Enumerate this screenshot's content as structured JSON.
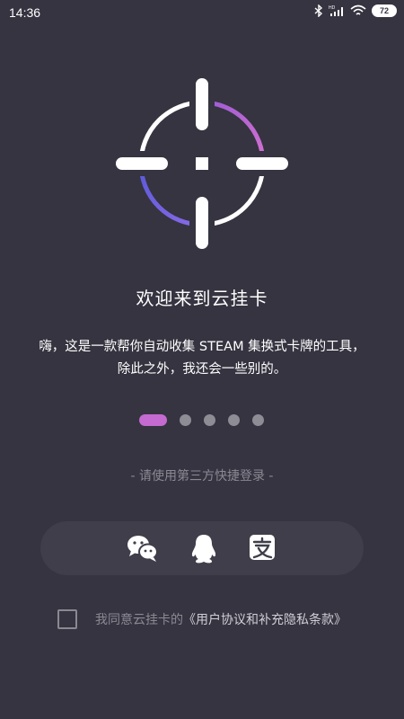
{
  "status_bar": {
    "time": "14:36",
    "battery": "72",
    "icons": [
      "bluetooth-icon",
      "hd-signal-icon",
      "wifi-icon",
      "battery-icon"
    ]
  },
  "welcome": {
    "title": "欢迎来到云挂卡",
    "description": "嗨，这是一款帮你自动收集 STEAM 集换式卡牌的工具，除此之外，我还会一些别的。"
  },
  "pager": {
    "total": 5,
    "active_index": 0
  },
  "login": {
    "divider_label": "- 请使用第三方快捷登录 -",
    "providers": [
      {
        "name": "wechat",
        "icon": "wechat-icon"
      },
      {
        "name": "qq",
        "icon": "qq-icon"
      },
      {
        "name": "alipay",
        "icon": "alipay-icon"
      }
    ]
  },
  "agreement": {
    "checked": false,
    "prefix": "我同意云挂卡的",
    "link": "《用户协议和补充隐私条款》"
  },
  "colors": {
    "background": "#353440",
    "accent_pink": "#c46ad0",
    "accent_purple": "#6f66e0",
    "muted_text": "#8b8993"
  }
}
